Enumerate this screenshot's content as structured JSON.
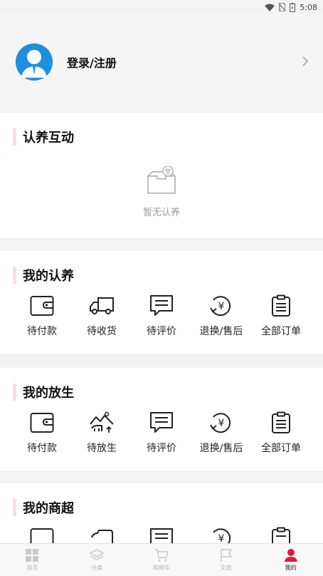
{
  "status_bar": {
    "time": "5:08"
  },
  "profile": {
    "login_label": "登录/注册"
  },
  "adopt_interact": {
    "title": "认养互动",
    "empty_text": "暂无认养",
    "empty_badge": "空"
  },
  "my_adopt": {
    "title": "我的认养",
    "items": [
      {
        "label": "待付款",
        "icon": "wallet-icon"
      },
      {
        "label": "待收货",
        "icon": "truck-icon"
      },
      {
        "label": "待评价",
        "icon": "comment-icon"
      },
      {
        "label": "退换/售后",
        "icon": "refund-icon"
      },
      {
        "label": "全部订单",
        "icon": "clipboard-icon"
      }
    ]
  },
  "my_release": {
    "title": "我的放生",
    "items": [
      {
        "label": "待付款",
        "icon": "wallet-icon"
      },
      {
        "label": "待放生",
        "icon": "release-icon"
      },
      {
        "label": "待评价",
        "icon": "comment-icon"
      },
      {
        "label": "退换/售后",
        "icon": "refund-icon"
      },
      {
        "label": "全部订单",
        "icon": "clipboard-icon"
      }
    ]
  },
  "my_mall": {
    "title": "我的商超"
  },
  "tabs": [
    {
      "label": "首页",
      "icon": "grid-icon"
    },
    {
      "label": "分类",
      "icon": "layers-icon"
    },
    {
      "label": "购物车",
      "icon": "cart-icon"
    },
    {
      "label": "文旅",
      "icon": "flag-icon"
    },
    {
      "label": "我的",
      "icon": "user-icon",
      "active": true
    }
  ],
  "colors": {
    "accent": "#e8163b",
    "avatar": "#1e8fdc",
    "title_bar": "#f9dde4"
  }
}
